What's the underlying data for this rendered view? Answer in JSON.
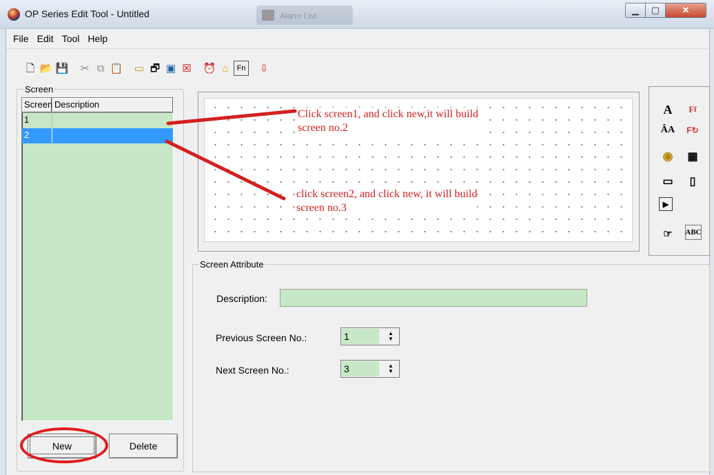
{
  "window": {
    "title": "OP Series Edit Tool - Untitled",
    "ghost_tab": "Alarm List"
  },
  "menu": [
    "File",
    "Edit",
    "Tool",
    "Help"
  ],
  "toolbar_icons": [
    "new-file-icon",
    "open-folder-icon",
    "save-icon",
    "sep",
    "cut-icon",
    "copy-icon",
    "paste-icon",
    "sep",
    "rectangle-icon",
    "screen-properties-icon",
    "window-icon",
    "delete-screen-icon",
    "sep",
    "alarm-clock-icon",
    "home-icon",
    "function-key-icon",
    "sep",
    "download-icon"
  ],
  "screen_group": {
    "legend": "Screen",
    "columns": [
      "Screen",
      "Description"
    ],
    "rows": [
      {
        "no": "1",
        "desc": ""
      },
      {
        "no": "2",
        "desc": ""
      }
    ],
    "new_button": "New",
    "delete_button": "Delete"
  },
  "annotations": {
    "first": "Click screen1, and click new,it will build\nscreen no.2",
    "second": "click screen2, and click new, it will build\nscreen no.3"
  },
  "sidebar_icons": [
    {
      "name": "text-icon",
      "glyph": "A"
    },
    {
      "name": "dynamic-text-icon",
      "glyph": "F"
    },
    {
      "name": "text-rotate-icon",
      "glyph": "Â"
    },
    {
      "name": "dynamic-text-rotate-icon",
      "glyph": "F"
    },
    {
      "name": "lamp-icon",
      "glyph": "◉"
    },
    {
      "name": "pattern-icon",
      "glyph": "▦"
    },
    {
      "name": "keyboard-icon",
      "glyph": "▭"
    },
    {
      "name": "display-icon",
      "glyph": "▯"
    },
    {
      "name": "play-button-icon",
      "glyph": "▶"
    },
    {
      "name": "ascii-input-icon",
      "glyph": "☞"
    },
    {
      "name": "abc-icon",
      "glyph": "ABC"
    }
  ],
  "attributes": {
    "legend": "Screen Attribute",
    "description_label": "Description:",
    "description_value": "",
    "prev_label": "Previous Screen No.:",
    "prev_value": "1",
    "next_label": "Next Screen No.:",
    "next_value": "3"
  },
  "colors": {
    "annotation": "#d42020",
    "list_bg": "#c6e8c6",
    "selected": "#3399ff"
  }
}
